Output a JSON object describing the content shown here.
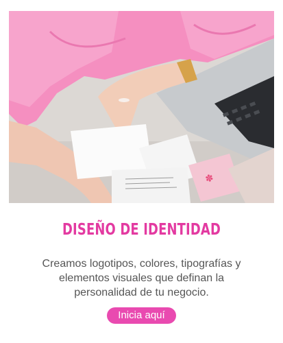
{
  "card": {
    "image_alt": "Manos sobre tarjetas de identidad junto a un portátil",
    "title": "DISEÑO DE IDENTIDAD",
    "description": "Creamos logotipos, colores, tipografías y elementos visuales que definan la personalidad de tu negocio.",
    "cta_label": "Inicia aquí"
  },
  "colors": {
    "accent": "#e33aa1",
    "button": "#e94ab0",
    "text": "#555555"
  }
}
